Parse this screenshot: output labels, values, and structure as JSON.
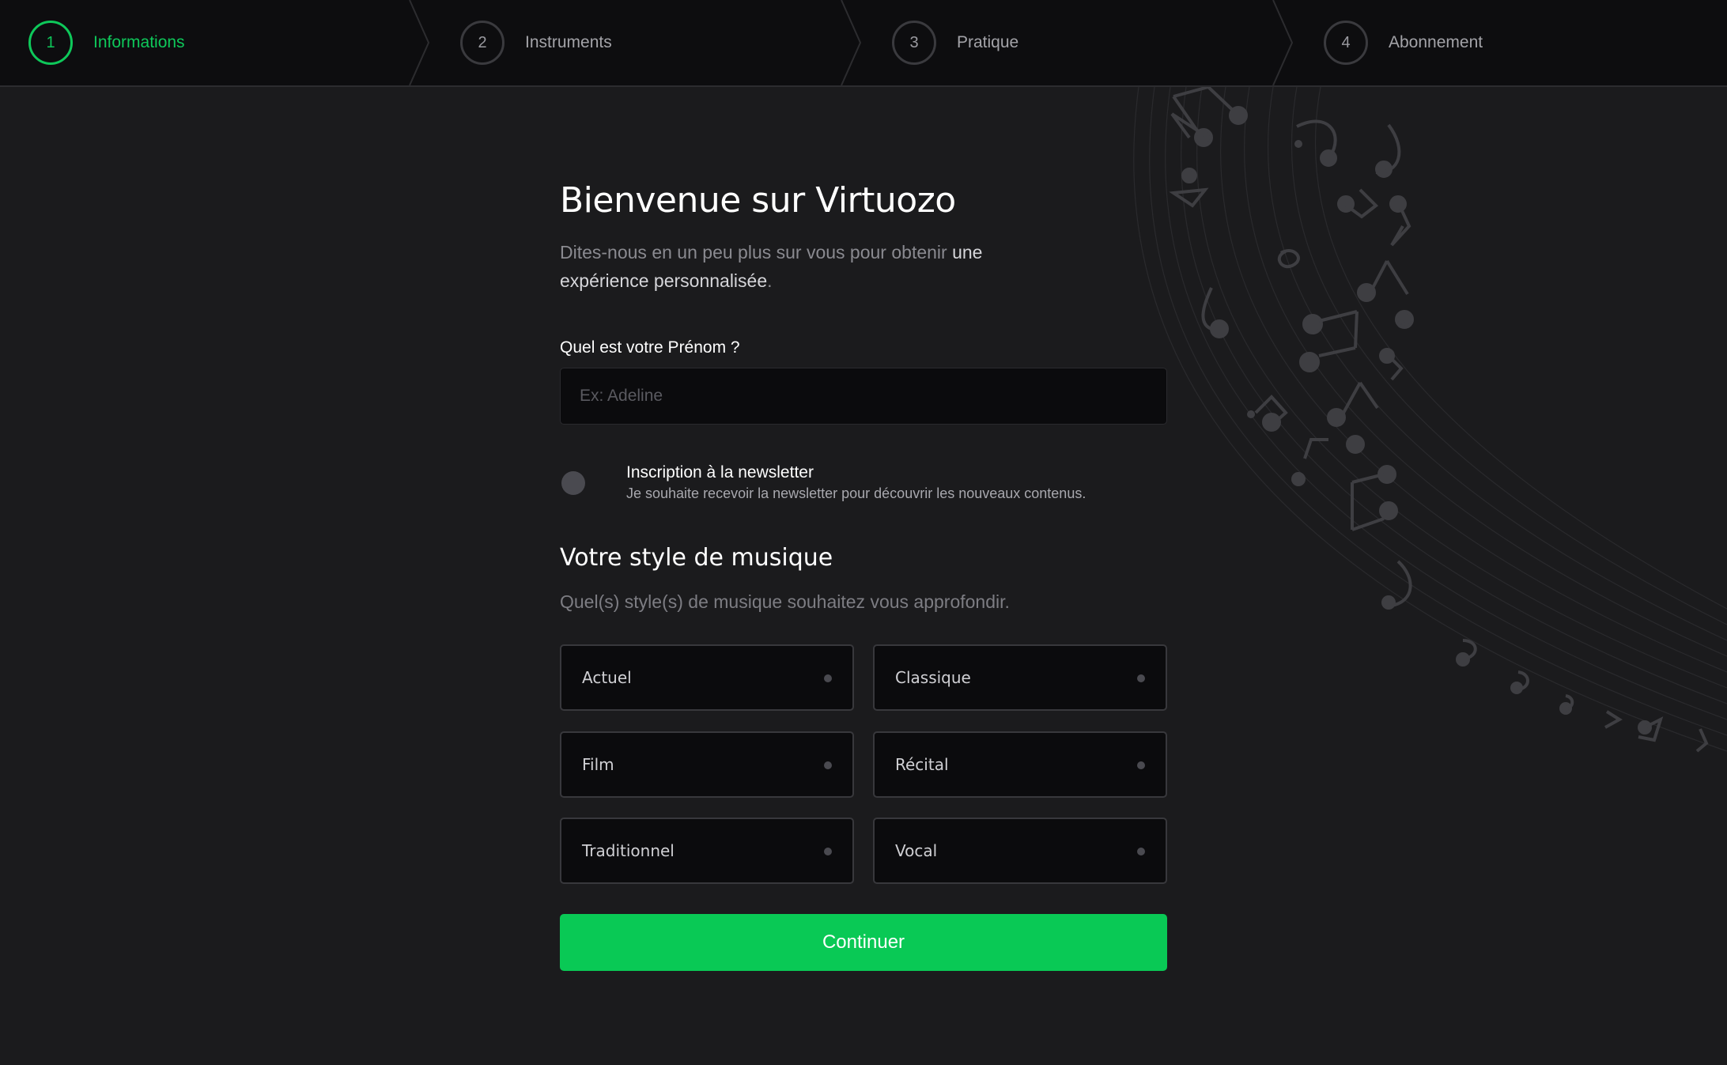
{
  "stepper": {
    "steps": [
      {
        "number": "1",
        "label": "Informations",
        "active": true
      },
      {
        "number": "2",
        "label": "Instruments",
        "active": false
      },
      {
        "number": "3",
        "label": "Pratique",
        "active": false
      },
      {
        "number": "4",
        "label": "Abonnement",
        "active": false
      }
    ]
  },
  "main": {
    "title": "Bienvenue sur Virtuozo",
    "subtitle_part1": "Dites-nous en un peu plus sur vous pour obtenir ",
    "subtitle_highlight1": "une",
    "subtitle_highlight2": "expérience personnalisée",
    "subtitle_end": ".",
    "name_label": "Quel est votre Prénom ?",
    "name_placeholder": "Ex: Adeline",
    "name_value": "",
    "newsletter": {
      "title": "Inscription à la newsletter",
      "description": "Je souhaite recevoir la newsletter pour découvrir les nouveaux contenus.",
      "checked": false
    },
    "style_section_title": "Votre style de musique",
    "style_section_subtitle": "Quel(s) style(s) de musique souhaitez vous approfondir.",
    "styles": [
      "Actuel",
      "Classique",
      "Film",
      "Récital",
      "Traditionnel",
      "Vocal"
    ],
    "continue_label": "Continuer"
  },
  "colors": {
    "accent": "#09c955",
    "background": "#1b1b1d",
    "header_bg": "#0d0d0f",
    "card_bg": "#0b0b0d"
  },
  "icons": [
    "music-notes-decoration-icon"
  ]
}
